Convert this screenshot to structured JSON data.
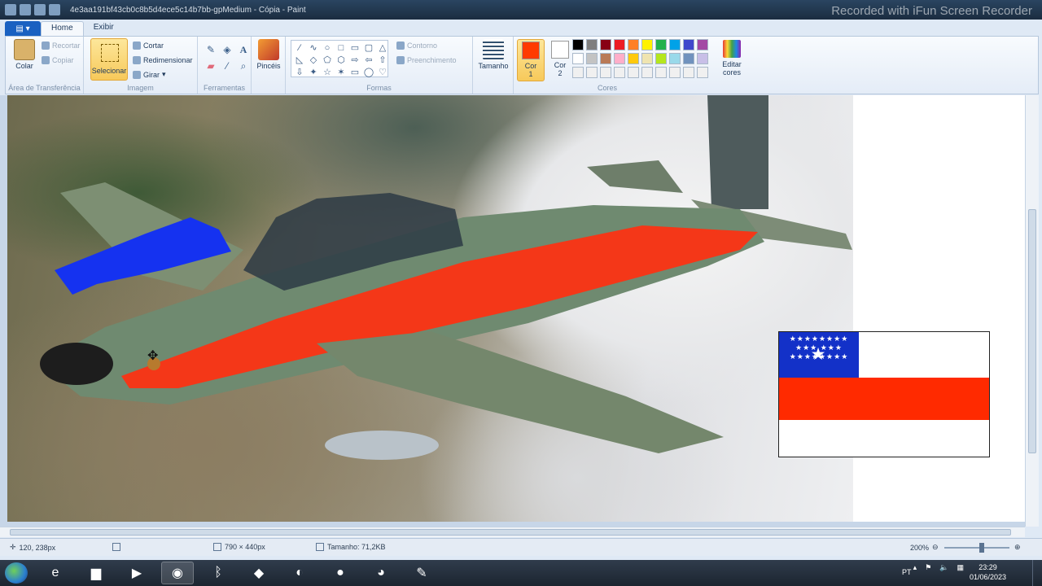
{
  "window": {
    "title": "4e3aa191bf43cb0c8b5d4ece5c14b7bb-gpMedium - Cópia - Paint",
    "overlay_text": "Recorded with iFun Screen Recorder"
  },
  "ribbon_tabs": [
    {
      "label": "Home",
      "active": true
    },
    {
      "label": "Exibir",
      "active": false
    }
  ],
  "ribbon": {
    "clipboard": {
      "paste_label": "Colar",
      "cut_label": "Recortar",
      "copy_label": "Copiar",
      "group_label": "Área de Transferência"
    },
    "image": {
      "select_label": "Selecionar",
      "crop_label": "Cortar",
      "resize_label": "Redimensionar",
      "rotate_label": "Girar",
      "group_label": "Imagem"
    },
    "tools": {
      "group_label": "Ferramentas",
      "icons": [
        "pencil-icon",
        "fill-icon",
        "text-icon",
        "eraser-icon",
        "color-picker-icon",
        "magnifier-icon"
      ]
    },
    "brushes": {
      "label": "Pincéis"
    },
    "shapes": {
      "outline_label": "Contorno",
      "fill_label": "Preenchimento",
      "group_label": "Formas",
      "glyphs": [
        "∕",
        "∿",
        "○",
        "□",
        "▭",
        "▢",
        "△",
        "◺",
        "◇",
        "⬠",
        "⬡",
        "⇨",
        "⇦",
        "⇧",
        "⇩",
        "✦",
        "☆",
        "✶",
        "▭",
        "◯",
        "♡"
      ]
    },
    "size": {
      "label": "Tamanho"
    },
    "colors": {
      "color1_label": "Cor\n1",
      "color2_label": "Cor\n2",
      "color1": "#ff3a00",
      "color2": "#ffffff",
      "edit_label": "Editar cores",
      "group_label": "Cores",
      "palette": [
        "#000000",
        "#7f7f7f",
        "#880015",
        "#ed1c24",
        "#ff7f27",
        "#fff200",
        "#22b14c",
        "#00a2e8",
        "#3f48cc",
        "#a349a4",
        "#ffffff",
        "#c3c3c3",
        "#b97a57",
        "#ffaec9",
        "#ffc90e",
        "#efe4b0",
        "#b5e61d",
        "#99d9ea",
        "#7092be",
        "#c8bfe7",
        "#f0f0f0",
        "#f0f0f0",
        "#f0f0f0",
        "#f0f0f0",
        "#f0f0f0",
        "#f0f0f0",
        "#f0f0f0",
        "#f0f0f0",
        "#f0f0f0",
        "#f0f0f0"
      ]
    }
  },
  "canvas": {
    "flag": {
      "canton_color": "#1331c8",
      "stripe_color": "#ff2a00",
      "canton_stars_rows": [
        "★★★★★★★★",
        "★★★     ★★★",
        "★★★★★★★★"
      ],
      "center_star": "★"
    }
  },
  "status": {
    "cursor_position": "120, 238px",
    "image_dimensions": "790 × 440px",
    "file_size": "Tamanho: 71,2KB",
    "zoom": "200%"
  },
  "taskbar": {
    "apps": [
      {
        "name": "internet-explorer-icon",
        "glyph": "e"
      },
      {
        "name": "file-explorer-icon",
        "glyph": "▆"
      },
      {
        "name": "media-player-icon",
        "glyph": "▶"
      },
      {
        "name": "chrome-icon",
        "glyph": "◉"
      },
      {
        "name": "bluetooth-icon",
        "glyph": "ᛒ"
      },
      {
        "name": "shield-app-icon",
        "glyph": "◆"
      },
      {
        "name": "edge-icon",
        "glyph": "◐"
      },
      {
        "name": "screen-recorder-icon",
        "glyph": "●"
      },
      {
        "name": "firefox-icon",
        "glyph": "◕"
      },
      {
        "name": "paint-icon",
        "glyph": "✎"
      }
    ],
    "language": "PT",
    "time": "23:29",
    "date": "01/06/2023"
  }
}
